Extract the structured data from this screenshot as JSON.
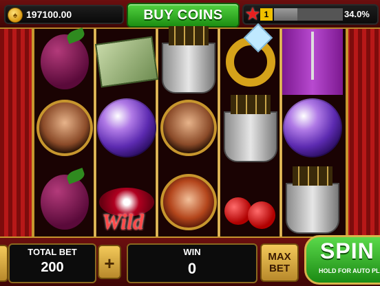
{
  "header": {
    "coins": "197100.00",
    "buy_coins_label": "BUY COINS",
    "level": "1",
    "xp_progress": 0.34,
    "xp_percent_text": "34.0%"
  },
  "reels": {
    "wild_label": "Wild",
    "grid": [
      [
        "plum",
        "portrait-brunette",
        "plum"
      ],
      [
        "money",
        "disco-ball",
        "lips-wild"
      ],
      [
        "champagne-bucket",
        "portrait-woman",
        "portrait-redhead"
      ],
      [
        "ring",
        "champagne-bucket",
        "cherries"
      ],
      [
        "stage-pole",
        "disco-ball",
        "champagne-bucket"
      ]
    ]
  },
  "controls": {
    "total_bet_label": "TOTAL BET",
    "total_bet_value": "200",
    "plus_label": "+",
    "win_label": "WIN",
    "win_value": "0",
    "max_bet_label": "MAX BET",
    "spin_label": "SPIN",
    "spin_hint": "HOLD FOR AUTO PLAY"
  },
  "colors": {
    "accent_gold": "#c7962e",
    "button_green": "#1c8f12",
    "background_red": "#6b0f0f"
  }
}
